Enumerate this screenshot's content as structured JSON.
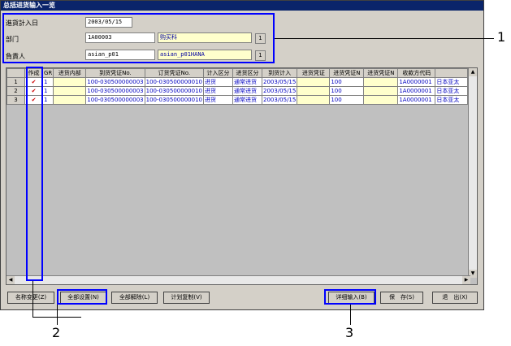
{
  "window": {
    "title": "总括进货输入一览"
  },
  "header": {
    "date_label": "進貨計入日",
    "date_value": "2003/05/15",
    "dept_label": "部门",
    "dept_code": "1A00003",
    "dept_name": "购买科",
    "person_label": "負責人",
    "person_code": "asian_p01",
    "person_name": "asian_p01HANA",
    "lookup_btn": "1"
  },
  "grid": {
    "columns": [
      "作成",
      "GR",
      "进货内部",
      "到货凭证No.",
      "订货凭证No.",
      "计入区分",
      "进货区分",
      "到货计入",
      "进货凭证",
      "进货凭证N",
      "进货凭证N",
      "收款方代码",
      ""
    ],
    "rows": [
      {
        "num": "1",
        "gr": "1",
        "arr": "100-030500000003",
        "ord": "100-030500000010",
        "cat": "进货",
        "kind": "通常进货",
        "date": "2003/05/15",
        "v": "100",
        "code": "1A0000001",
        "name": "日本亚太"
      },
      {
        "num": "2",
        "gr": "1",
        "arr": "100-030500000003",
        "ord": "100-030500000010",
        "cat": "进货",
        "kind": "通常进货",
        "date": "2003/05/15",
        "v": "100",
        "code": "1A0000001",
        "name": "日本亚太"
      },
      {
        "num": "3",
        "gr": "1",
        "arr": "100-030500000003",
        "ord": "100-030500000010",
        "cat": "进货",
        "kind": "通常进货",
        "date": "2003/05/15",
        "v": "100",
        "code": "1A0000001",
        "name": "日本亚太"
      }
    ]
  },
  "buttons": {
    "name_change": "名称变更(Z)",
    "select_all": "全部设置(N)",
    "clear_all": "全部解除(L)",
    "plan_copy": "计划复制(V)",
    "detail_input": "详细输入(B)",
    "save": "保　存(S)",
    "exit": "退　出(X)"
  },
  "callouts": {
    "c1": "1",
    "c2": "2",
    "c3": "3"
  },
  "colors": {
    "callout": "#0000ff",
    "title_bg": "#0a246a",
    "highlight_yellow": "#ffffcc"
  }
}
